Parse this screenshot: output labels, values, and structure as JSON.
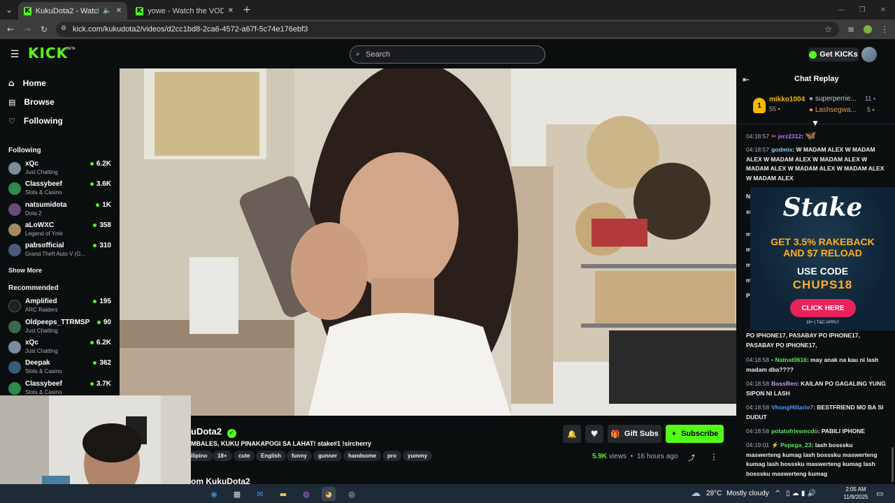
{
  "browser": {
    "tabs": [
      {
        "title": "KukuDota2 - Watch the VC",
        "active": true
      },
      {
        "title": "yowe - Watch the VOD on Kick",
        "active": false
      }
    ],
    "url": "kick.com/kukudota2/videos/d2cc1bd8-2ca6-4572-a67f-5c74e176ebf3"
  },
  "header": {
    "logo": "KICK",
    "beta": "BETA",
    "search_placeholder": "Search",
    "get_kicks": "Get KICKs"
  },
  "nav": {
    "home": "Home",
    "browse": "Browse",
    "following": "Following"
  },
  "sidebar": {
    "following_title": "Following",
    "following": [
      {
        "name": "xQc",
        "game": "Just Chatting",
        "viewers": "6.2K",
        "color": "#7a8c9e"
      },
      {
        "name": "Classybeef",
        "game": "Slots & Casino",
        "viewers": "3.6K",
        "color": "#2f8a4a"
      },
      {
        "name": "natsumidota",
        "game": "Dota 2",
        "viewers": "1K",
        "color": "#6a4a7a"
      },
      {
        "name": "aLoWXC",
        "game": "Legend of Ymir",
        "viewers": "358",
        "color": "#a08a60"
      },
      {
        "name": "pabsofficial",
        "game": "Grand Theft Auto V (G...",
        "viewers": "310",
        "color": "#4a5a7a"
      }
    ],
    "show_more": "Show More",
    "recommended_title": "Recommended",
    "recommended": [
      {
        "name": "Amplified",
        "game": "ARC Raiders",
        "viewers": "195",
        "color": "#202020"
      },
      {
        "name": "Oldpeeps_TTRMSP",
        "game": "Just Chatting",
        "viewers": "90",
        "color": "#3a6a4a"
      },
      {
        "name": "xQc",
        "game": "Just Chatting",
        "viewers": "6.2K",
        "color": "#7a8c9e"
      },
      {
        "name": "Deepak",
        "game": "Slots & Casino",
        "viewers": "362",
        "color": "#3a5a7a"
      },
      {
        "name": "Classybeef",
        "game": "Slots & Casino",
        "viewers": "3.7K",
        "color": "#2f8a4a"
      }
    ]
  },
  "stream": {
    "streamer": "KukuDota2",
    "title_visible": "uDota2",
    "subtitle": "MBALES, KUKU PINAKAPOGI SA LAHAT! stake#1 !sircherry",
    "tags": [
      "ilipino",
      "18+",
      "cute",
      "English",
      "funny",
      "gunner",
      "handsome",
      "pro",
      "yummy"
    ],
    "views": "5.9K",
    "views_label": "views",
    "age": "16 hours ago",
    "gift_subs": "Gift Subs",
    "subscribe": "Subscribe",
    "about": "om KukuDota2"
  },
  "chat": {
    "title": "Chat Replay",
    "leaderboard": {
      "top_name": "mikko1004",
      "top_rank": "1",
      "top_count": "55",
      "second_name": "superperrie...",
      "second_count": "11",
      "third_name": "Lashsegwa...",
      "third_count": "5"
    },
    "messages": [
      {
        "time": "04:18:57",
        "user": "jerz2312",
        "color": "#b870ff",
        "text": ""
      },
      {
        "time": "04:18:57",
        "user": "godmix",
        "color": "#7ad4ff",
        "text": "W MADAM ALEX W MADAM ALEX W MADAM ALEX W MADAM ALEX W MADAM ALEX W MADAM ALEX W MADAM ALEX W MADAM ALEX"
      },
      {
        "time": "04:18:58",
        "user": "Natnat0616",
        "color": "#5ae85a",
        "text": "may anak na kau ni lash madam dba????"
      },
      {
        "time": "04:18:58",
        "user": "BossRen",
        "color": "#c99aff",
        "text": "KAILAN PO GAGALING YUNG SIPON NI LASH"
      },
      {
        "time": "04:18:58",
        "user": "VhongHillario7",
        "color": "#4a9cff",
        "text": "BESTFRIEND MO BA SI DUDUT"
      },
      {
        "time": "04:18:58",
        "user": "potatofriesmcdo",
        "color": "#5ae85a",
        "text": "PABILI IPHONE"
      },
      {
        "time": "04:19:01",
        "user": "Pepega_23",
        "color": "#5ae85a",
        "text": "lash bosssku maswerteng kumag lash bosssku maswerteng kumag lash bosssku maswerteng kumag lash bosssku maswerteng kumag"
      }
    ],
    "partial_text": "PO IPHONE17, PASABAY PO IPHONE17, PASABAY PO IPHONE17,",
    "partial_prefix": "P\nIP",
    "cut_letters": [
      "N",
      "su",
      "m",
      "m",
      "m",
      "m",
      "P"
    ]
  },
  "ad": {
    "brand": "Stake",
    "line1": "GET 3.5% RAKEBACK",
    "line2": "AND $7 RELOAD",
    "use_code": "USE CODE",
    "code": "CHUPS18",
    "cta": "CLICK HERE",
    "fine": "18+ | T&C APPLY"
  },
  "taskbar": {
    "weather_temp": "28°C",
    "weather_text": "Mostly cloudy",
    "time": "2:05 AM",
    "date": "11/9/2025"
  },
  "colors": {
    "accent": "#53fc18",
    "background": "#0b0e0f",
    "surface": "#25282c"
  }
}
